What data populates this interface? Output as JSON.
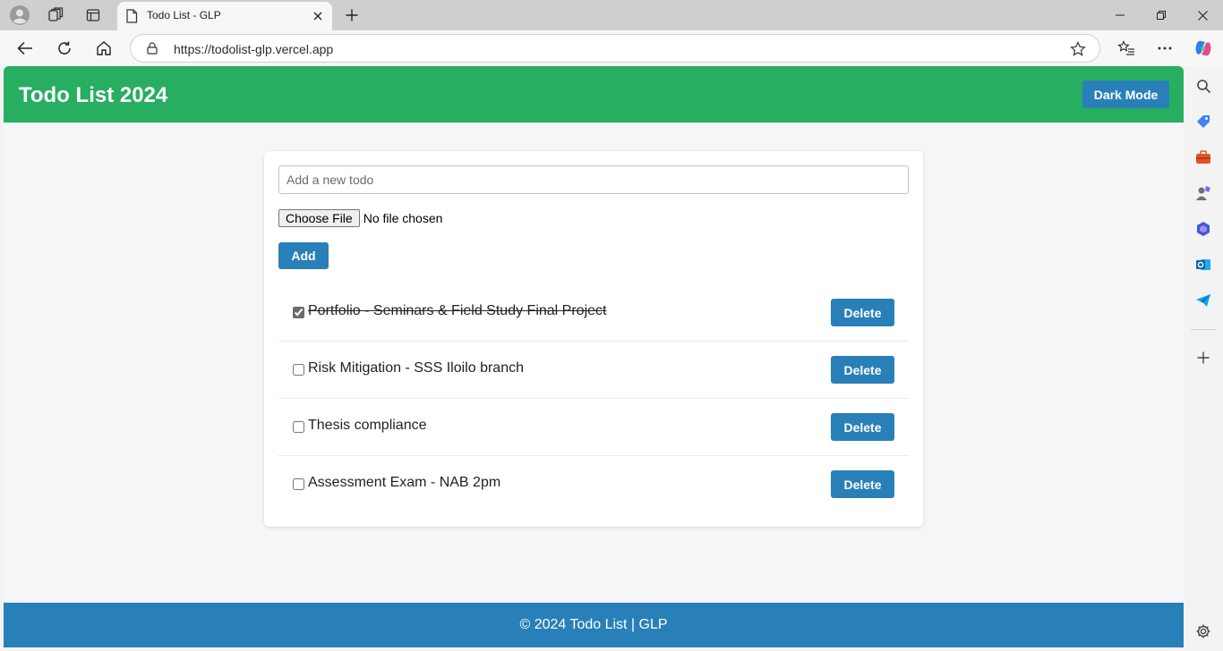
{
  "browser": {
    "tab_title": "Todo List - GLP",
    "url": "https://todolist-glp.vercel.app"
  },
  "app": {
    "title": "Todo List 2024",
    "dark_mode_label": "Dark Mode",
    "input_placeholder": "Add a new todo",
    "input_value": "",
    "file_button_label": "Choose File",
    "file_status": "No file chosen",
    "add_label": "Add",
    "delete_label": "Delete",
    "todos": [
      {
        "text": "Portfolio - Seminars & Field Study Final Project",
        "completed": true
      },
      {
        "text": "Risk Mitigation - SSS Iloilo branch",
        "completed": false
      },
      {
        "text": "Thesis compliance",
        "completed": false
      },
      {
        "text": "Assessment Exam - NAB 2pm",
        "completed": false
      }
    ],
    "footer_text": "© 2024 Todo List | GLP"
  },
  "colors": {
    "header_bg": "#27ae60",
    "primary_button": "#2980b9",
    "footer_bg": "#2980b9",
    "page_bg": "#f4f6f8"
  },
  "icons": {
    "tabstrip": [
      "profile-icon",
      "workspaces-icon",
      "vertical-tabs-icon"
    ],
    "toolbar": [
      "back-icon",
      "refresh-icon",
      "home-icon",
      "lock-icon",
      "favorite-star-icon",
      "favorites-list-icon",
      "more-menu-icon",
      "copilot-icon"
    ],
    "sidebar": [
      "search-icon",
      "shopping-tag-icon",
      "tools-icon",
      "games-icon",
      "microsoft365-icon",
      "outlook-icon",
      "telegram-send-icon",
      "add-icon",
      "settings-icon"
    ]
  }
}
